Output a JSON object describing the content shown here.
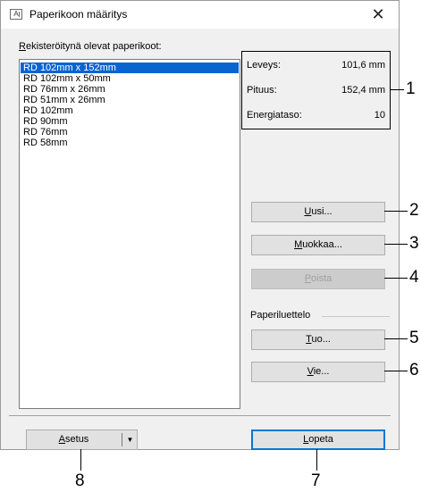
{
  "window": {
    "title": "Paperikoon määritys",
    "icon_text": "A"
  },
  "paper_list": {
    "label_mnemonic": "R",
    "label_rest": "ekisteröitynä olevat paperikoot:",
    "items": [
      "RD 102mm x 152mm",
      "RD 102mm x 50mm",
      "RD 76mm x 26mm",
      "RD 51mm x 26mm",
      "RD 102mm",
      "RD 90mm",
      "RD 76mm",
      "RD 58mm"
    ],
    "selected_index": 0
  },
  "info": {
    "width_label": "Leveys:",
    "width_value": "101,6 mm",
    "length_label": "Pituus:",
    "length_value": "152,4 mm",
    "energy_label": "Energiataso:",
    "energy_value": "10"
  },
  "buttons": {
    "new_mn": "U",
    "new_rest": "usi...",
    "edit_mn": "M",
    "edit_rest": "uokkaa...",
    "delete_mn": "P",
    "delete_rest": "oista",
    "import_mn": "T",
    "import_rest": "uo...",
    "export_mn": "V",
    "export_rest": "ie...",
    "settings_mn": "A",
    "settings_rest": "setus",
    "close_mn": "L",
    "close_rest": "opeta"
  },
  "paper_list_group": "Paperiluettelo",
  "callouts": [
    "1",
    "2",
    "3",
    "4",
    "5",
    "6",
    "7",
    "8"
  ],
  "colors": {
    "selection": "#0a64d0",
    "dialog_bg": "#f0f0f0",
    "primary_border": "#0078d7"
  }
}
